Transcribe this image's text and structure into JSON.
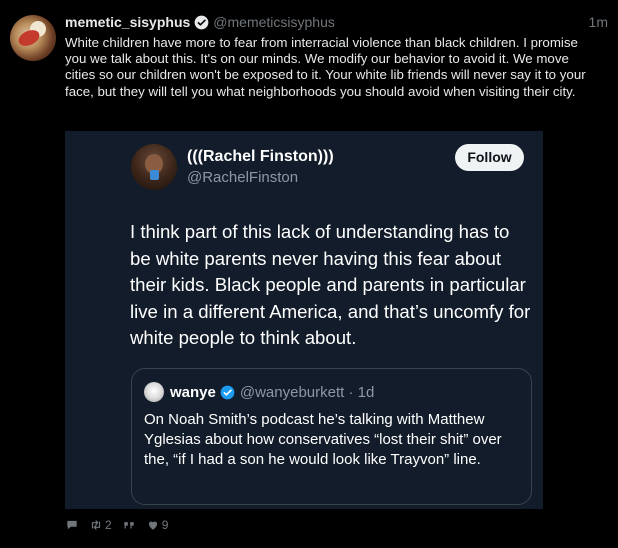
{
  "post": {
    "display_name": "memetic_sisyphus",
    "handle": "@memeticsisyphus",
    "timestamp": "1m",
    "text": "White children have more to fear from interracial violence than black children. I promise you we talk about this. It's on our minds. We modify our behavior to avoid it. We move cities so our children won't be exposed to it. Your white lib friends will never say it to your face, but they will tell you what neighborhoods you should avoid when visiting their city.",
    "actions": {
      "reply_icon": "speech-bubble-icon",
      "retweet_icon": "retweet-icon",
      "retweet_count": "2",
      "quote_icon": "quote-icon",
      "like_icon": "heart-icon",
      "like_count": "9"
    }
  },
  "quoted": {
    "display_name": "(((Rachel Finston)))",
    "handle": "@RachelFinston",
    "follow_label": "Follow",
    "text": "I think part of this lack of understanding has to be white parents never having this fear about their kids. Black people and parents in particular live in a different America, and that’s uncomfy for white people to think about.",
    "nested": {
      "display_name": "wanye",
      "handle_time": "@wanyeburkett · 1d",
      "text": "On Noah Smith’s podcast he’s talking with Matthew Yglesias about how conservatives “lost their shit” over the, “if I had a son he would look like Trayvon” line."
    }
  },
  "colors": {
    "background": "#000000",
    "card_background": "#131c2a",
    "verified_blue": "#1d9bf0",
    "muted_text": "#71767b"
  }
}
